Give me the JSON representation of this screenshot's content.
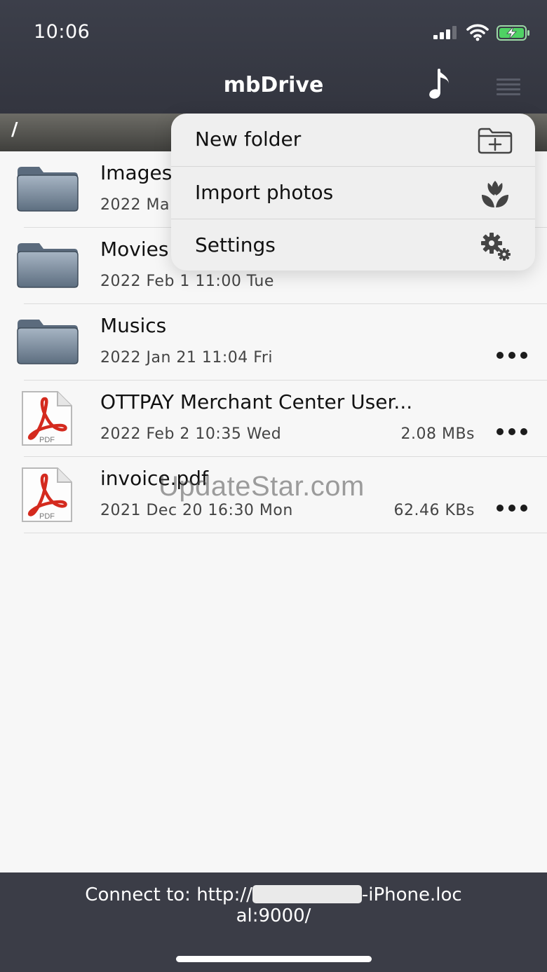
{
  "status_bar": {
    "time": "10:06"
  },
  "header": {
    "title": "mbDrive",
    "music_icon": "music-note-icon",
    "menu_icon": "menu-icon"
  },
  "path": {
    "current": "/"
  },
  "files": [
    {
      "name": "Images",
      "date": "2022 Ma",
      "size": "",
      "type": "folder"
    },
    {
      "name": "Movies",
      "date": "2022 Feb 1  11:00 Tue",
      "size": "",
      "type": "folder"
    },
    {
      "name": "Musics",
      "date": "2022 Jan 21  11:04 Fri",
      "size": "",
      "type": "folder"
    },
    {
      "name": "OTTPAY Merchant Center User...",
      "date": "2022 Feb 2  10:35 Wed",
      "size": "2.08 MBs",
      "type": "pdf"
    },
    {
      "name": "invoice.pdf",
      "date": "2021 Dec 20  16:30 Mon",
      "size": "62.46 KBs",
      "type": "pdf"
    }
  ],
  "menu": {
    "items": [
      {
        "label": "New folder",
        "icon": "new-folder-icon"
      },
      {
        "label": "Import photos",
        "icon": "flower-icon"
      },
      {
        "label": "Settings",
        "icon": "gears-icon"
      }
    ]
  },
  "watermark": "UpdateStar.com",
  "footer": {
    "connect_prefix": "Connect to: http://",
    "connect_suffix": "-iPhone.loc",
    "connect_line2": "al:9000/"
  },
  "colors": {
    "topbar": "#3c3f4a",
    "pdf_red": "#d42a1e",
    "folder_blue": "#6e7f92"
  }
}
